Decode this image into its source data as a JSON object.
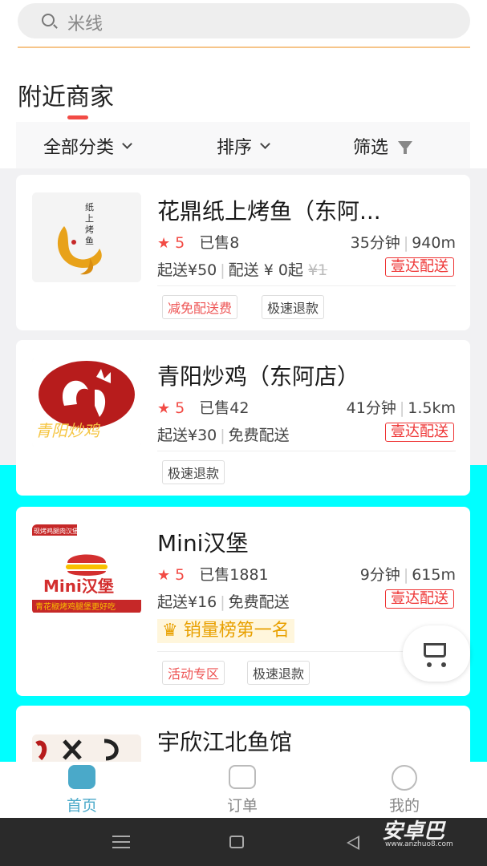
{
  "search": {
    "placeholder": "米线"
  },
  "section": {
    "title": "附近商家"
  },
  "filters": {
    "category": "全部分类",
    "sort": "排序",
    "filter": "筛选"
  },
  "stores": [
    {
      "name": "花鼎纸上烤鱼（东阿...",
      "rating": "5",
      "sold": "已售8",
      "time": "35分钟",
      "distance": "940m",
      "min_order": "起送¥50",
      "delivery_fee": "配送 ¥ 0起",
      "original_fee": "¥1",
      "badge": "壹达配送",
      "tags": [
        "减免配送费",
        "极速退款"
      ],
      "logo_text": "纸上烤鱼"
    },
    {
      "name": "青阳炒鸡（东阿店）",
      "rating": "5",
      "sold": "已售42",
      "time": "41分钟",
      "distance": "1.5km",
      "min_order": "起送¥30",
      "delivery_fee": "免费配送",
      "badge": "壹达配送",
      "tags": [
        "极速退款"
      ],
      "logo_text": "青阳炒鸡"
    },
    {
      "name": "Mini汉堡",
      "rating": "5",
      "sold": "已售1881",
      "time": "9分钟",
      "distance": "615m",
      "min_order": "起送¥16",
      "delivery_fee": "免费配送",
      "badge": "壹达配送",
      "rank": "销量榜第一名",
      "tags": [
        "活动专区",
        "极速退款"
      ],
      "logo_text": "Mini汉堡",
      "logo_top": "现烤鸡腿肉汉堡",
      "logo_bottom": "青花椒烤鸡腿堡更好吃"
    },
    {
      "name": "宇欣江北鱼馆"
    }
  ],
  "nav": [
    {
      "label": "首页",
      "active": true
    },
    {
      "label": "订单",
      "active": false
    },
    {
      "label": "我的",
      "active": false
    }
  ],
  "watermark": {
    "main": "安卓巴",
    "sub": "www.anzhuo8.com"
  },
  "colors": {
    "accent": "#f24b45",
    "active_nav": "#4aa9c9",
    "highlight_bg": "#00ffff",
    "rank_color": "#e8a000"
  }
}
